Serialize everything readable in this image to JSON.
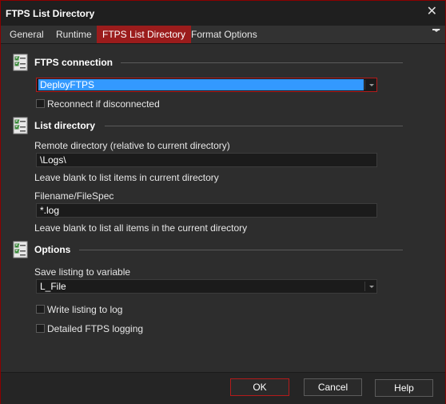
{
  "window": {
    "title": "FTPS List Directory",
    "close_glyph": "✕"
  },
  "tabs": [
    {
      "label": "General"
    },
    {
      "label": "Runtime"
    },
    {
      "label": "FTPS List Directory",
      "active": true
    },
    {
      "label": "Format Options"
    }
  ],
  "sections": {
    "connection": {
      "title": "FTPS connection",
      "icon": "checklist-icon",
      "combo_value": "DeployFTPS",
      "reconnect_label": "Reconnect if disconnected",
      "reconnect_checked": false
    },
    "list_directory": {
      "title": "List directory",
      "icon": "checklist-icon",
      "remote_dir_label": "Remote directory (relative to current directory)",
      "remote_dir_value": "\\Logs\\",
      "remote_dir_hint": "Leave blank to list items in current directory",
      "filespec_label": "Filename/FileSpec",
      "filespec_value": "*.log",
      "filespec_hint": "Leave blank to list all items in the current directory"
    },
    "options": {
      "title": "Options",
      "icon": "checklist-icon",
      "save_var_label": "Save listing to variable",
      "save_var_value": "L_File",
      "write_log_label": "Write listing to log",
      "write_log_checked": false,
      "detailed_label": "Detailed FTPS logging",
      "detailed_checked": false
    }
  },
  "buttons": {
    "ok": "OK",
    "cancel": "Cancel",
    "help": "Help"
  },
  "colors": {
    "accent": "#9b1c1c",
    "selection": "#3399ff",
    "background": "#2d2d2d"
  }
}
